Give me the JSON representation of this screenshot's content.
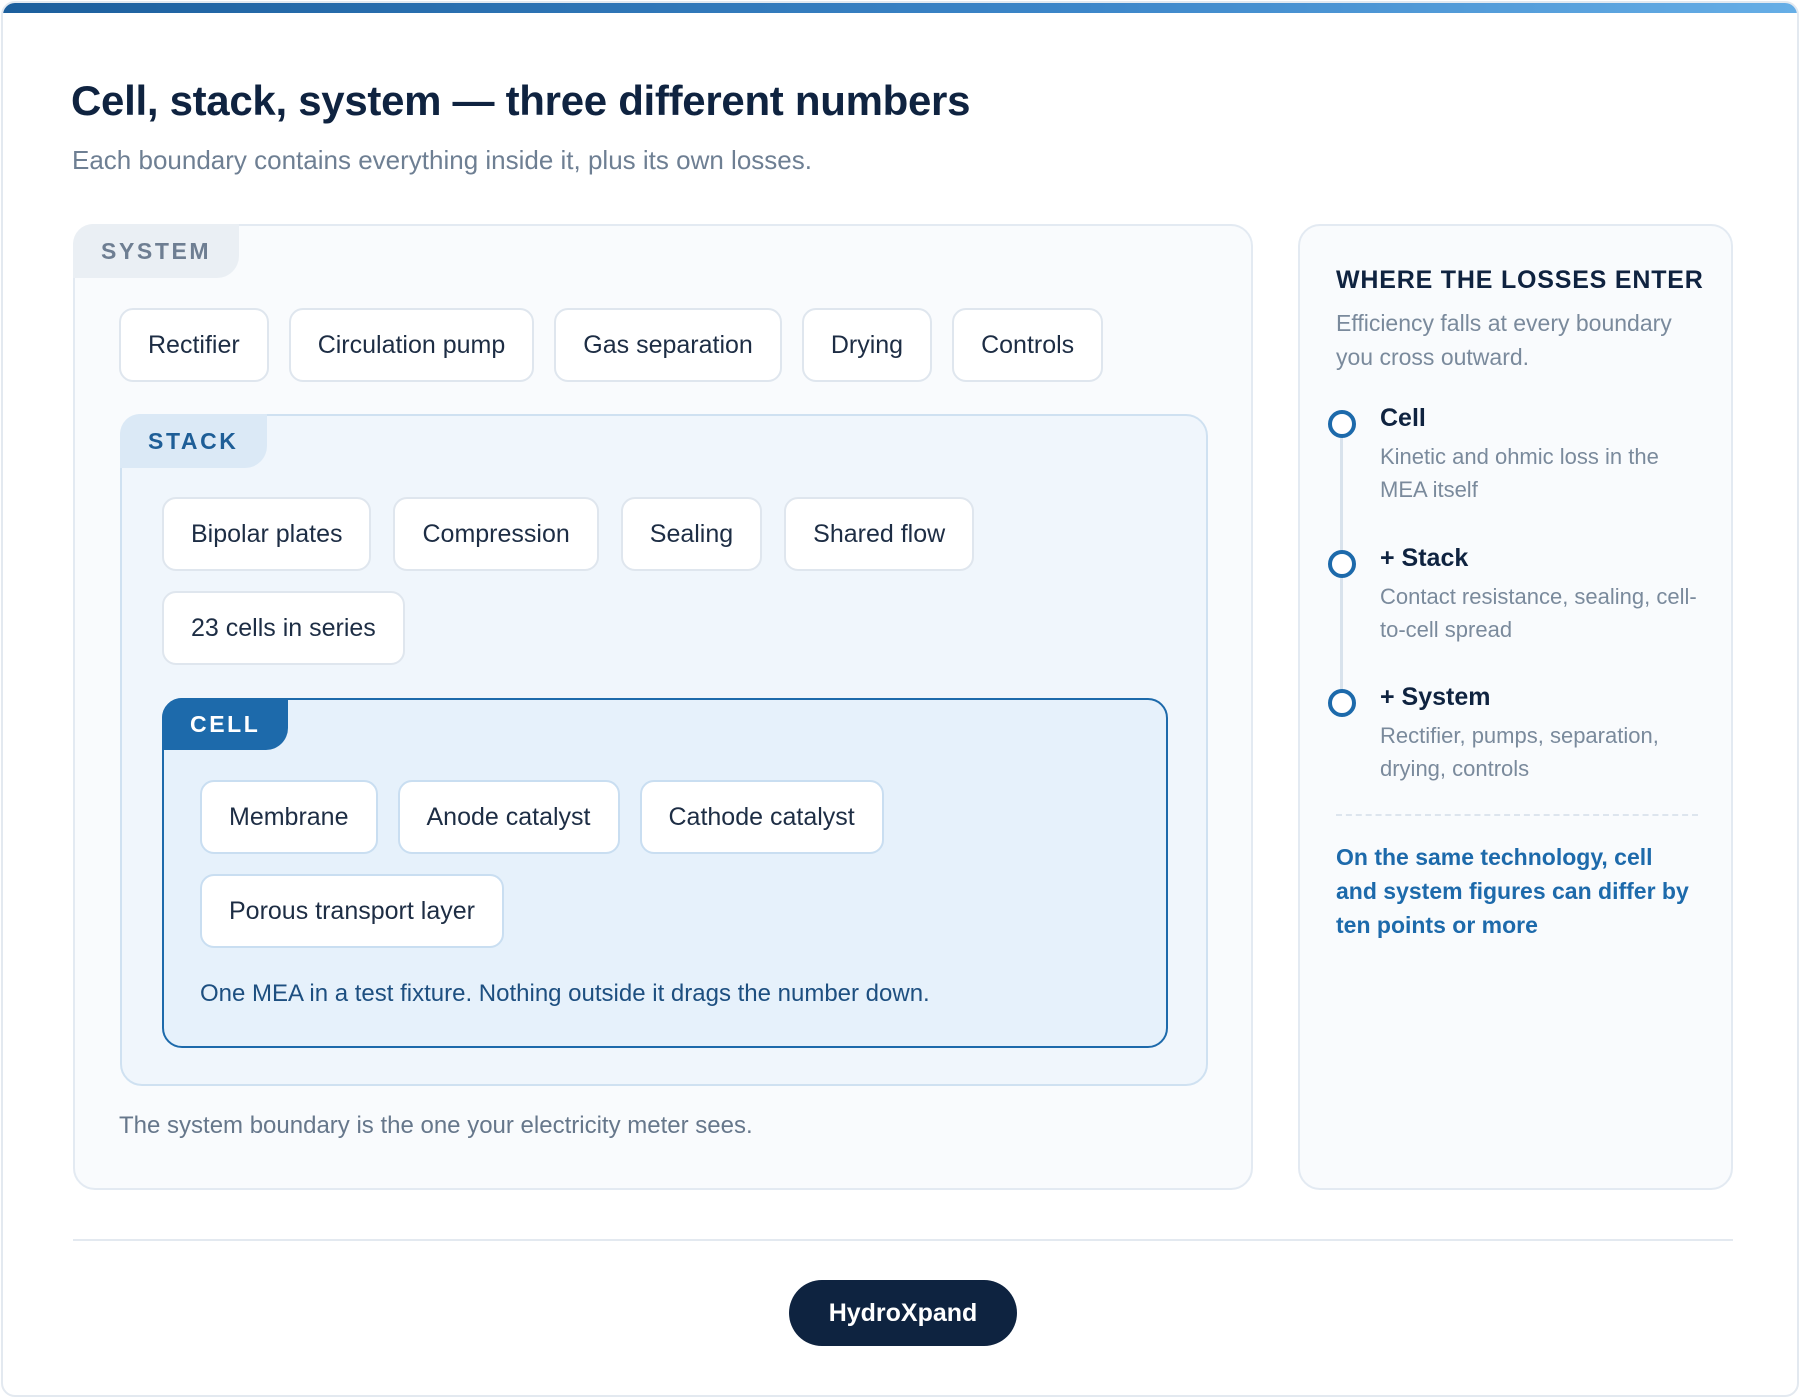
{
  "header": {
    "title": "Cell, stack, system — three different numbers",
    "subtitle": "Each boundary contains everything inside it, plus its own losses."
  },
  "system": {
    "label": "SYSTEM",
    "components": [
      "Rectifier",
      "Circulation pump",
      "Gas separation",
      "Drying",
      "Controls"
    ],
    "note": "The system boundary is the one your electricity meter sees."
  },
  "stack": {
    "label": "STACK",
    "components": [
      "Bipolar plates",
      "Compression",
      "Sealing",
      "Shared flow",
      "23 cells in series"
    ]
  },
  "cell": {
    "label": "CELL",
    "components": [
      "Membrane",
      "Anode catalyst",
      "Cathode catalyst",
      "Porous transport layer"
    ],
    "note": "One MEA in a test fixture. Nothing outside it drags the number down."
  },
  "losses_panel": {
    "title": "WHERE THE LOSSES ENTER",
    "subtitle": "Efficiency falls at every boundary you cross outward.",
    "steps": [
      {
        "name": "Cell",
        "description": "Kinetic and ohmic loss in the MEA itself"
      },
      {
        "name": "+ Stack",
        "description": "Contact resistance, sealing, cell-to-cell spread"
      },
      {
        "name": "+ System",
        "description": "Rectifier, pumps, separation, drying, controls"
      }
    ],
    "callout": "On the same technology, cell and system figures can differ by ten points or more"
  },
  "footer": {
    "brand": "HydroXpand"
  },
  "colors": {
    "accent": "#1d6aab",
    "navy": "#0e2340",
    "muted": "#7a8a9c"
  }
}
